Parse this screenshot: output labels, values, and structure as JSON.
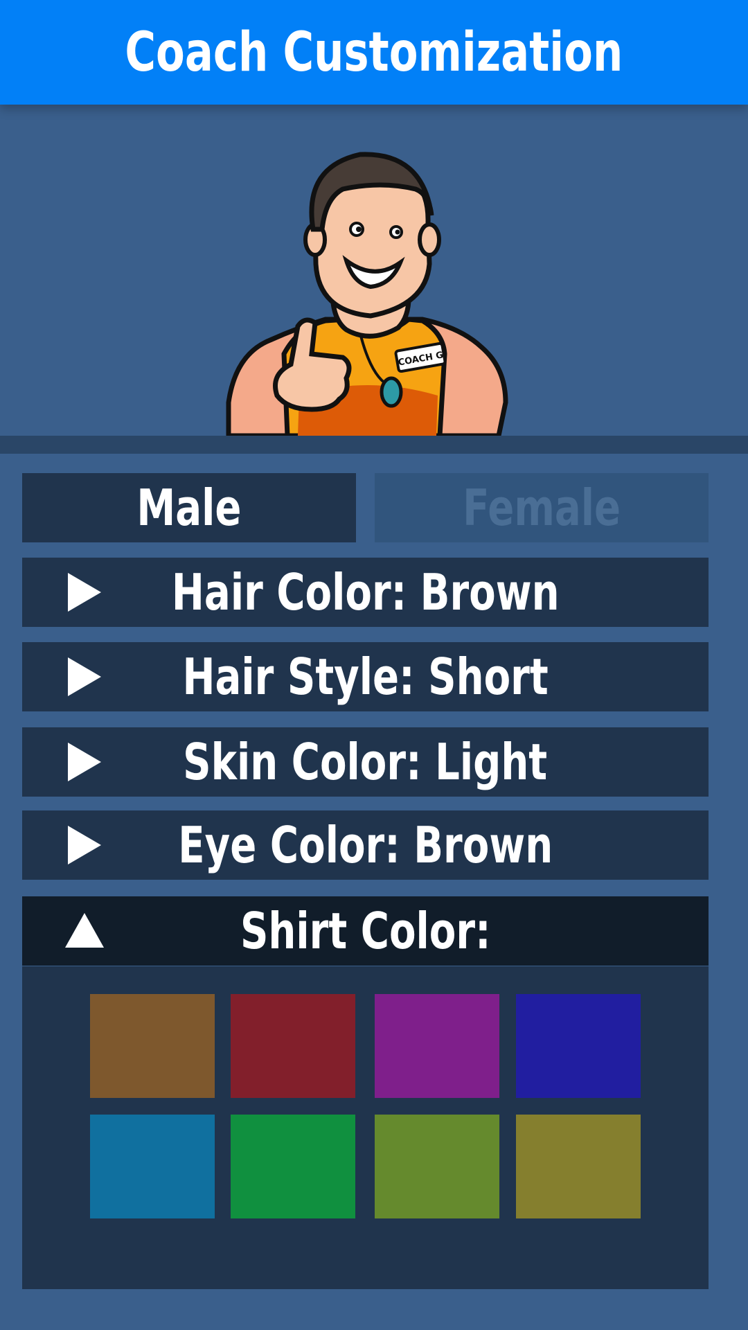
{
  "header": {
    "title": "Coach Customization"
  },
  "avatar": {
    "badge_text": "COACH G"
  },
  "gender": {
    "male_label": "Male",
    "female_label": "Female",
    "selected": "Male"
  },
  "options": [
    {
      "label": "Hair Color: Brown",
      "icon": "play-right-icon"
    },
    {
      "label": "Hair Style: Short",
      "icon": "play-right-icon"
    },
    {
      "label": "Skin Color: Light",
      "icon": "play-right-icon"
    },
    {
      "label": "Eye Color: Brown",
      "icon": "play-right-icon"
    }
  ],
  "shirt": {
    "label": "Shirt Color:",
    "icon": "triangle-up-icon",
    "swatches": [
      "#7e582d",
      "#821f2b",
      "#7f1f8b",
      "#211ea0",
      "#10709f",
      "#10903f",
      "#658a2d",
      "#857f2e"
    ]
  },
  "colors": {
    "header": "#0280f7",
    "background": "#3a5f8c",
    "bar": "#20344d",
    "bar_selected": "#111d2a",
    "female_inactive_bg": "#31557d",
    "female_inactive_text": "#4a6e95"
  }
}
